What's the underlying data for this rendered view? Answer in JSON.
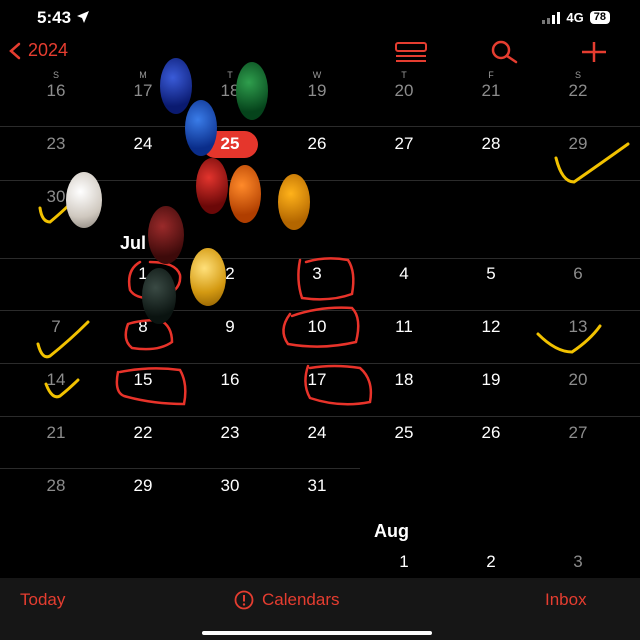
{
  "status": {
    "time": "5:43",
    "network": "4G",
    "battery": "78"
  },
  "nav": {
    "back_label": "2024"
  },
  "weekdays": [
    "S",
    "M",
    "T",
    "W",
    "T",
    "F",
    "S"
  ],
  "weeks_june": [
    [
      "16",
      "17",
      "18",
      "19",
      "20",
      "21",
      "22"
    ],
    [
      "23",
      "24",
      "25",
      "26",
      "27",
      "28",
      "29"
    ],
    [
      "30"
    ]
  ],
  "july_label": "Jul",
  "weeks_july": [
    [
      "1",
      "2",
      "3",
      "4",
      "5",
      "6"
    ],
    [
      "7",
      "8",
      "9",
      "10",
      "11",
      "12",
      "13"
    ],
    [
      "14",
      "15",
      "16",
      "17",
      "18",
      "19",
      "20"
    ],
    [
      "21",
      "22",
      "23",
      "24",
      "25",
      "26",
      "27"
    ],
    [
      "28",
      "29",
      "30",
      "31"
    ]
  ],
  "aug_label": "Aug",
  "weeks_aug": [
    [
      "1",
      "2",
      "3"
    ]
  ],
  "tabbar": {
    "today": "Today",
    "calendars": "Calendars",
    "inbox": "Inbox"
  },
  "colors": {
    "accent": "#e53d30",
    "today_circle": "#e5362c",
    "annotation_red": "#e8332a",
    "annotation_yellow": "#f2c200"
  },
  "icons": [
    "location-arrow-icon",
    "signal-icon",
    "chevron-left-icon",
    "list-view-icon",
    "search-icon",
    "plus-icon",
    "alert-circle-icon"
  ]
}
